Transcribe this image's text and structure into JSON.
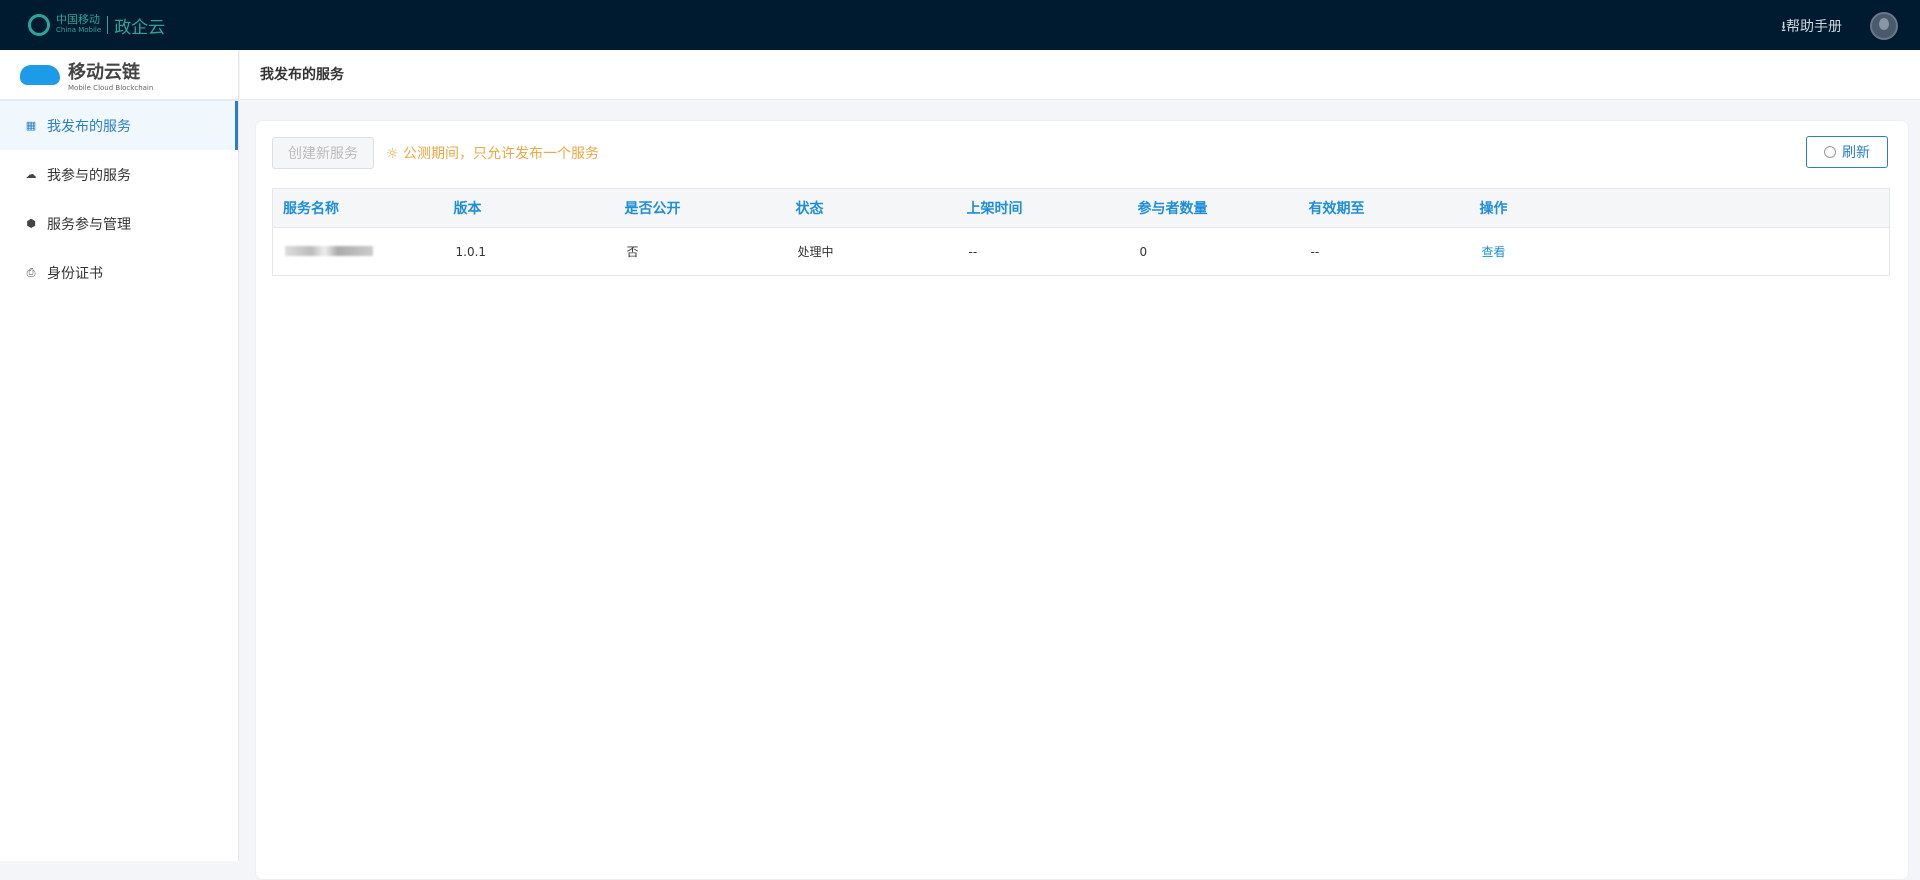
{
  "topbar": {
    "brand_cn": "中国移动",
    "brand_en": "China Mobile",
    "product": "政企云",
    "help": "帮助手册"
  },
  "sidebar": {
    "logo_title": "移动云链",
    "logo_sub": "Mobile Cloud Blockchain",
    "items": [
      {
        "label": "我发布的服务",
        "icon": "grid-icon",
        "active": true
      },
      {
        "label": "我参与的服务",
        "icon": "cloud-icon"
      },
      {
        "label": "服务参与管理",
        "icon": "cube-icon"
      },
      {
        "label": "身份证书",
        "icon": "certificate-icon"
      }
    ]
  },
  "page": {
    "title": "我发布的服务",
    "create_button": "创建新服务",
    "notice": "公测期间，只允许发布一个服务",
    "refresh_button": "刷新"
  },
  "table": {
    "headers": [
      "服务名称",
      "版本",
      "是否公开",
      "状态",
      "上架时间",
      "参与者数量",
      "有效期至",
      "操作"
    ],
    "rows": [
      {
        "name": "",
        "version": "1.0.1",
        "public": "否",
        "status": "处理中",
        "listed": "--",
        "participants": "0",
        "expires": "--",
        "action": "查看"
      }
    ]
  },
  "colors": {
    "topbar": "#001a30",
    "accent": "#2a7fc9",
    "notice": "#f0a640"
  }
}
